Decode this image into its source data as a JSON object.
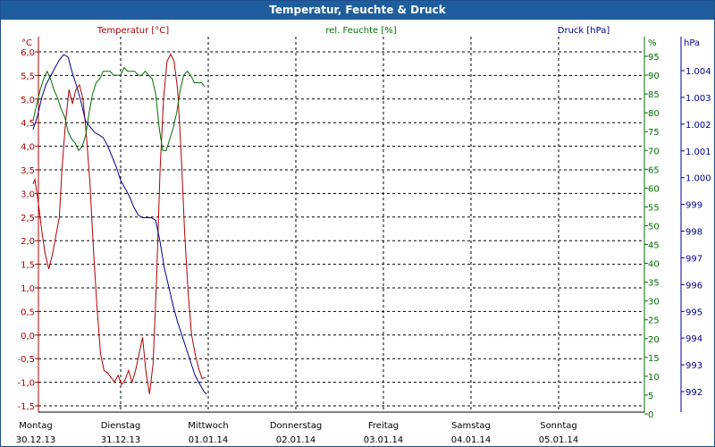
{
  "window": {
    "title": "Temperatur, Feuchte & Druck"
  },
  "colors": {
    "temperature": "#b00000",
    "humidity": "#007000",
    "pressure": "#000090",
    "grid": "#000000",
    "title_bar": "#1f5e9e"
  },
  "chart_data": {
    "type": "line",
    "title": "Temperatur, Feuchte & Druck",
    "grid": true,
    "x_axis": {
      "range": [
        0,
        6.8
      ],
      "unit_note": "days from 30.12.13",
      "ticks": [
        {
          "x": 0,
          "day": "Montag",
          "date": "30.12.13"
        },
        {
          "x": 1,
          "day": "Dienstag",
          "date": "31.12.13"
        },
        {
          "x": 2,
          "day": "Mittwoch",
          "date": "01.01.14"
        },
        {
          "x": 3,
          "day": "Donnerstag",
          "date": "02.01.14"
        },
        {
          "x": 4,
          "day": "Freitag",
          "date": "03.01.14"
        },
        {
          "x": 5,
          "day": "Samstag",
          "date": "04.01.14"
        },
        {
          "x": 6,
          "day": "Sonntag",
          "date": "05.01.14"
        }
      ]
    },
    "axes": {
      "temperature": {
        "label": "Temperatur [°C]",
        "unit": "°C",
        "range": [
          -1.5,
          6.0
        ],
        "ticks": [
          "6,0",
          "5,5",
          "5,0",
          "4,5",
          "4,0",
          "3,5",
          "3,0",
          "2,5",
          "2,0",
          "1,5",
          "1,0",
          "0,5",
          "0,0",
          "-0,5",
          "-1,0",
          "-1,5"
        ]
      },
      "humidity": {
        "label": "rel. Feuchte [%]",
        "unit": "%",
        "range": [
          0,
          95
        ],
        "ticks": [
          "95",
          "90",
          "85",
          "80",
          "75",
          "70",
          "65",
          "60",
          "55",
          "50",
          "45",
          "40",
          "35",
          "30",
          "25",
          "20",
          "15",
          "10",
          "5",
          "0"
        ]
      },
      "pressure": {
        "label": "Druck [hPa]",
        "unit": "hPa",
        "range": [
          991.3,
          1004.6
        ],
        "ticks": [
          "1.004",
          "1.003",
          "1.002",
          "1.001",
          "1.000",
          "999",
          "998",
          "997",
          "996",
          "995",
          "994",
          "993",
          "992"
        ]
      }
    },
    "series": [
      {
        "name": "Temperatur [°C]",
        "axis": "temperature",
        "color": "#b00000",
        "points": [
          [
            0.0,
            3.2
          ],
          [
            0.02,
            3.3
          ],
          [
            0.06,
            2.8
          ],
          [
            0.1,
            2.2
          ],
          [
            0.14,
            1.7
          ],
          [
            0.18,
            1.4
          ],
          [
            0.22,
            1.7
          ],
          [
            0.26,
            2.1
          ],
          [
            0.3,
            2.5
          ],
          [
            0.33,
            3.5
          ],
          [
            0.37,
            4.5
          ],
          [
            0.41,
            5.2
          ],
          [
            0.45,
            4.9
          ],
          [
            0.49,
            5.2
          ],
          [
            0.53,
            5.3
          ],
          [
            0.57,
            5.0
          ],
          [
            0.61,
            4.2
          ],
          [
            0.65,
            3.2
          ],
          [
            0.69,
            1.8
          ],
          [
            0.73,
            0.6
          ],
          [
            0.77,
            -0.4
          ],
          [
            0.81,
            -0.75
          ],
          [
            0.85,
            -0.8
          ],
          [
            0.89,
            -0.9
          ],
          [
            0.93,
            -1.0
          ],
          [
            0.97,
            -0.85
          ],
          [
            1.01,
            -1.05
          ],
          [
            1.05,
            -0.95
          ],
          [
            1.09,
            -0.75
          ],
          [
            1.13,
            -1.0
          ],
          [
            1.17,
            -0.75
          ],
          [
            1.21,
            -0.4
          ],
          [
            1.25,
            -0.05
          ],
          [
            1.29,
            -0.8
          ],
          [
            1.33,
            -1.25
          ],
          [
            1.37,
            -0.6
          ],
          [
            1.41,
            1.2
          ],
          [
            1.45,
            3.5
          ],
          [
            1.49,
            5.0
          ],
          [
            1.53,
            5.8
          ],
          [
            1.57,
            5.95
          ],
          [
            1.61,
            5.8
          ],
          [
            1.65,
            5.2
          ],
          [
            1.69,
            3.9
          ],
          [
            1.73,
            2.2
          ],
          [
            1.77,
            0.9
          ],
          [
            1.81,
            0.0
          ],
          [
            1.85,
            -0.4
          ],
          [
            1.89,
            -0.7
          ],
          [
            1.93,
            -0.92
          ],
          [
            1.97,
            -0.9
          ]
        ]
      },
      {
        "name": "rel. Feuchte [%]",
        "axis": "humidity",
        "color": "#007000",
        "points": [
          [
            0.0,
            78
          ],
          [
            0.04,
            82
          ],
          [
            0.08,
            86
          ],
          [
            0.12,
            89
          ],
          [
            0.16,
            91
          ],
          [
            0.2,
            89
          ],
          [
            0.24,
            86
          ],
          [
            0.28,
            84
          ],
          [
            0.32,
            81
          ],
          [
            0.36,
            79
          ],
          [
            0.4,
            75
          ],
          [
            0.44,
            73
          ],
          [
            0.48,
            72
          ],
          [
            0.52,
            70
          ],
          [
            0.56,
            71
          ],
          [
            0.6,
            74
          ],
          [
            0.64,
            80
          ],
          [
            0.68,
            85
          ],
          [
            0.72,
            88
          ],
          [
            0.76,
            89
          ],
          [
            0.8,
            91
          ],
          [
            0.84,
            91
          ],
          [
            0.88,
            91
          ],
          [
            0.92,
            90
          ],
          [
            0.96,
            90
          ],
          [
            1.0,
            90
          ],
          [
            1.04,
            92
          ],
          [
            1.08,
            91
          ],
          [
            1.12,
            91
          ],
          [
            1.16,
            91
          ],
          [
            1.2,
            90
          ],
          [
            1.24,
            90
          ],
          [
            1.28,
            91
          ],
          [
            1.32,
            90
          ],
          [
            1.36,
            89
          ],
          [
            1.4,
            85
          ],
          [
            1.44,
            76
          ],
          [
            1.48,
            70
          ],
          [
            1.52,
            70
          ],
          [
            1.56,
            73
          ],
          [
            1.6,
            76
          ],
          [
            1.64,
            80
          ],
          [
            1.68,
            86
          ],
          [
            1.72,
            90
          ],
          [
            1.76,
            91
          ],
          [
            1.8,
            90
          ],
          [
            1.84,
            88
          ],
          [
            1.88,
            88
          ],
          [
            1.92,
            88
          ],
          [
            1.96,
            87
          ]
        ]
      },
      {
        "name": "Druck [hPa]",
        "axis": "pressure",
        "color": "#000090",
        "points": [
          [
            0.0,
            1001.8
          ],
          [
            0.05,
            1002.3
          ],
          [
            0.1,
            1003.0
          ],
          [
            0.15,
            1003.5
          ],
          [
            0.2,
            1003.8
          ],
          [
            0.25,
            1004.1
          ],
          [
            0.3,
            1004.4
          ],
          [
            0.35,
            1004.6
          ],
          [
            0.4,
            1004.5
          ],
          [
            0.45,
            1003.9
          ],
          [
            0.5,
            1003.4
          ],
          [
            0.55,
            1002.8
          ],
          [
            0.6,
            1002.1
          ],
          [
            0.65,
            1001.9
          ],
          [
            0.7,
            1001.7
          ],
          [
            0.75,
            1001.6
          ],
          [
            0.8,
            1001.5
          ],
          [
            0.85,
            1001.2
          ],
          [
            0.9,
            1000.8
          ],
          [
            0.95,
            1000.4
          ],
          [
            1.0,
            999.9
          ],
          [
            1.05,
            999.6
          ],
          [
            1.1,
            999.3
          ],
          [
            1.15,
            998.9
          ],
          [
            1.2,
            998.6
          ],
          [
            1.25,
            998.5
          ],
          [
            1.3,
            998.5
          ],
          [
            1.35,
            998.5
          ],
          [
            1.4,
            998.4
          ],
          [
            1.45,
            997.6
          ],
          [
            1.5,
            996.6
          ],
          [
            1.55,
            995.9
          ],
          [
            1.6,
            995.2
          ],
          [
            1.65,
            994.6
          ],
          [
            1.7,
            994.1
          ],
          [
            1.75,
            993.6
          ],
          [
            1.8,
            993.1
          ],
          [
            1.85,
            992.6
          ],
          [
            1.9,
            992.3
          ],
          [
            1.95,
            992.0
          ],
          [
            1.98,
            991.9
          ]
        ]
      }
    ]
  }
}
